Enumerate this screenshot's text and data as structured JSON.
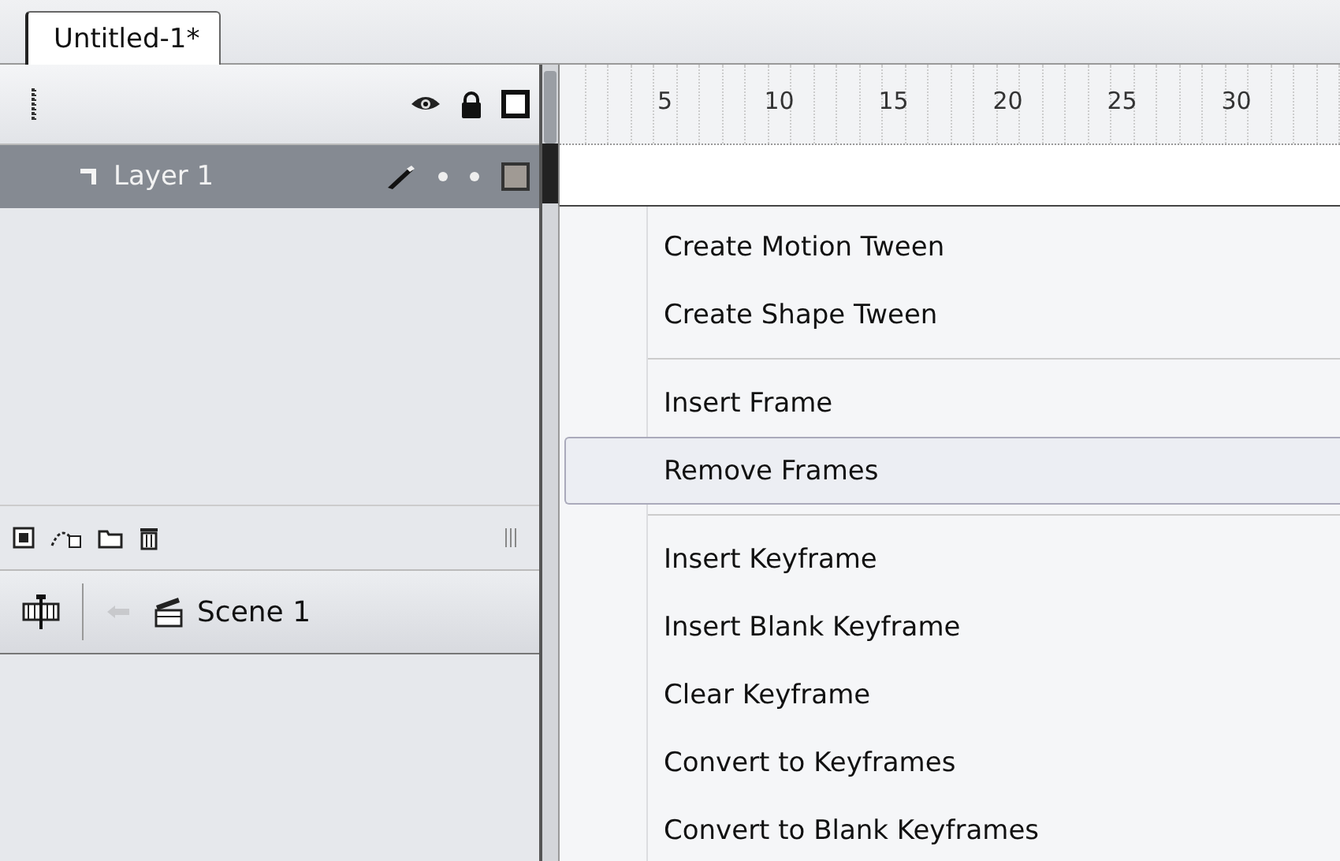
{
  "document_tab": {
    "label": "Untitled-1*",
    "selected": true
  },
  "layers": [
    {
      "name": "Layer 1",
      "selected": true
    }
  ],
  "ruler": {
    "labels": [
      "5",
      "10",
      "15",
      "20",
      "25",
      "30"
    ]
  },
  "scene": {
    "label": "Scene 1"
  },
  "context_menu": {
    "groups": [
      [
        {
          "label": "Create Motion Tween",
          "selected": false
        },
        {
          "label": "Create Shape Tween",
          "selected": false
        }
      ],
      [
        {
          "label": "Insert Frame",
          "selected": false
        },
        {
          "label": "Remove Frames",
          "selected": true
        }
      ],
      [
        {
          "label": "Insert Keyframe",
          "selected": false
        },
        {
          "label": "Insert Blank Keyframe",
          "selected": false
        },
        {
          "label": "Clear Keyframe",
          "selected": false
        },
        {
          "label": "Convert to Keyframes",
          "selected": false
        },
        {
          "label": "Convert to Blank Keyframes",
          "selected": false
        }
      ]
    ]
  }
}
